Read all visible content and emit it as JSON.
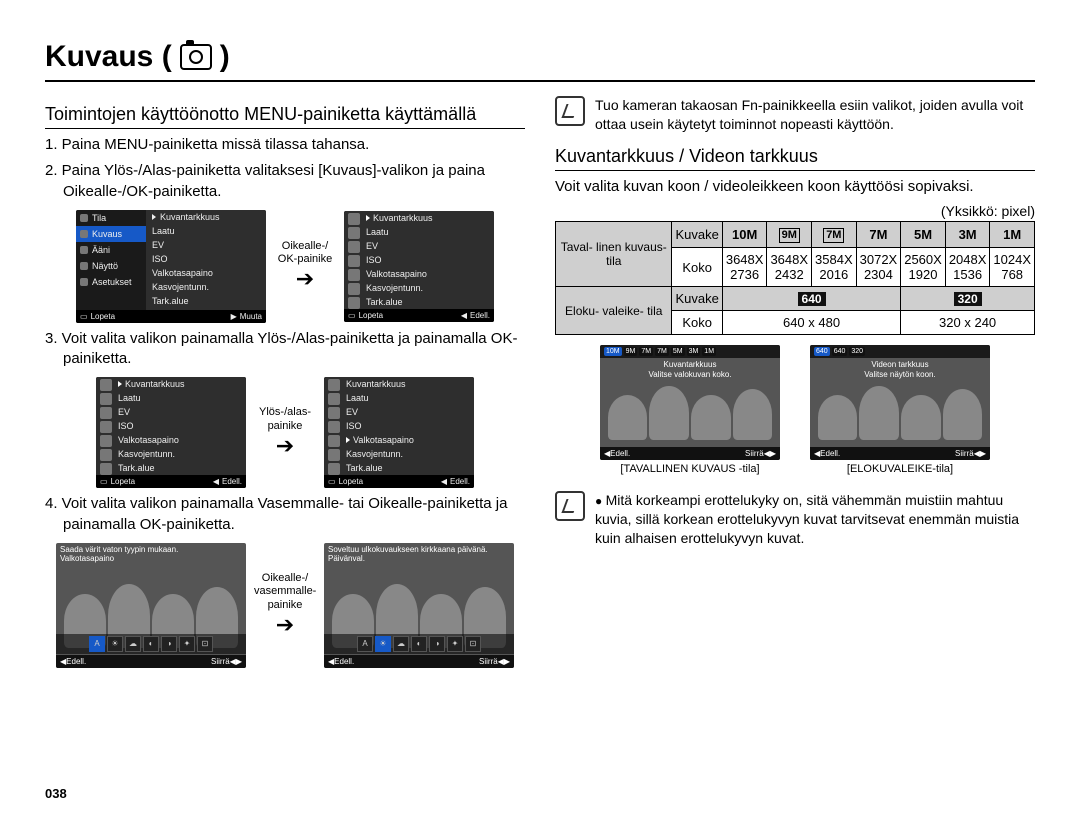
{
  "page_title_left": "Kuvaus (",
  "page_title_right": ")",
  "page_number": "038",
  "left": {
    "subhead": "Toimintojen käyttöönotto MENU-painiketta käyttämällä",
    "step1": "1. Paina MENU-painiketta missä tilassa tahansa.",
    "step2": "2. Paina Ylös-/Alas-painiketta valitaksesi [Kuvaus]-valikon ja paina Oikealle-/OK-painiketta.",
    "arrow1_label": "Oikealle-/ OK-painike",
    "step3": "3. Voit valita valikon painamalla Ylös-/Alas-painiketta ja painamalla OK-painiketta.",
    "arrow2_label": "Ylös-/alas- painike",
    "step4": "4. Voit valita valikon painamalla Vasemmalle- tai Oikealle-painiketta ja painamalla OK-painiketta.",
    "arrow3_label": "Oikealle-/ vasemmalle- painike",
    "menu1_left": [
      "Tila",
      "Kuvaus",
      "Ääni",
      "Näyttö",
      "Asetukset"
    ],
    "menu1_right": [
      "Kuvantarkkuus",
      "Laatu",
      "EV",
      "ISO",
      "Valkotasapaino",
      "Kasvojentunn.",
      "Tark.alue"
    ],
    "menu1_foot_left": "Lopeta",
    "menu1_foot_right": "Muuta",
    "menu2_foot_left": "Lopeta",
    "menu2_foot_right": "Edell.",
    "photo4a_line1": "Saada värit vaton tyypin mukaan.",
    "photo4a_line2": "Valkotasapaino",
    "photo4b_line1": "Soveltuu ulkokuvaukseen kirkkaana päivänä.",
    "photo4b_line2": "Päivänval.",
    "photo_foot_back": "Edell.",
    "photo_foot_move": "Siirrä"
  },
  "right": {
    "note1": "Tuo kameran takaosan Fn-painikkeella esiin valikot, joiden avulla voit ottaa usein käytetyt toiminnot nopeasti käyttöön.",
    "subhead": "Kuvantarkkuus / Videon tarkkuus",
    "intro": "Voit valita kuvan koon / videoleikkeen koon käyttöösi sopivaksi.",
    "unit": "(Yksikkö: pixel)",
    "table": {
      "row1_head": "Taval- linen kuvaus- tila",
      "row1_icon_label": "Kuvake",
      "row1_icons": [
        "10M",
        "9M",
        "7M",
        "7M",
        "5M",
        "3M",
        "1M"
      ],
      "row1_size_label": "Koko",
      "row1_sizes_top": [
        "3648X",
        "3648X",
        "3584X",
        "3072X",
        "2560X",
        "2048X",
        "1024X"
      ],
      "row1_sizes_bot": [
        "2736",
        "2432",
        "2016",
        "2304",
        "1920",
        "1536",
        "768"
      ],
      "row2_head": "Eloku- valeike- tila",
      "row2_icon_label": "Kuvake",
      "row2_icons": [
        "640",
        "320"
      ],
      "row2_size_label": "Koko",
      "row2_sizes": [
        "640 x 480",
        "320 x 240"
      ]
    },
    "shotA_over1": "Kuvantarkkuus",
    "shotA_over2": "Valitse valokuvan koko.",
    "shotA_caption": "[TAVALLINEN KUVAUS -tila]",
    "shotB_over1": "Videon tarkkuus",
    "shotB_over2": "Valitse näytön koon.",
    "shotB_caption": "[ELOKUVALEIKE-tila]",
    "shotB_chips": [
      "640",
      "640",
      "320"
    ],
    "note2": "Mitä korkeampi erottelukyky on, sitä vähemmän muistiin mahtuu kuvia, sillä korkean erottelukyvyn kuvat tarvitsevat enemmän muistia kuin alhaisen erottelukyvyn kuvat."
  }
}
